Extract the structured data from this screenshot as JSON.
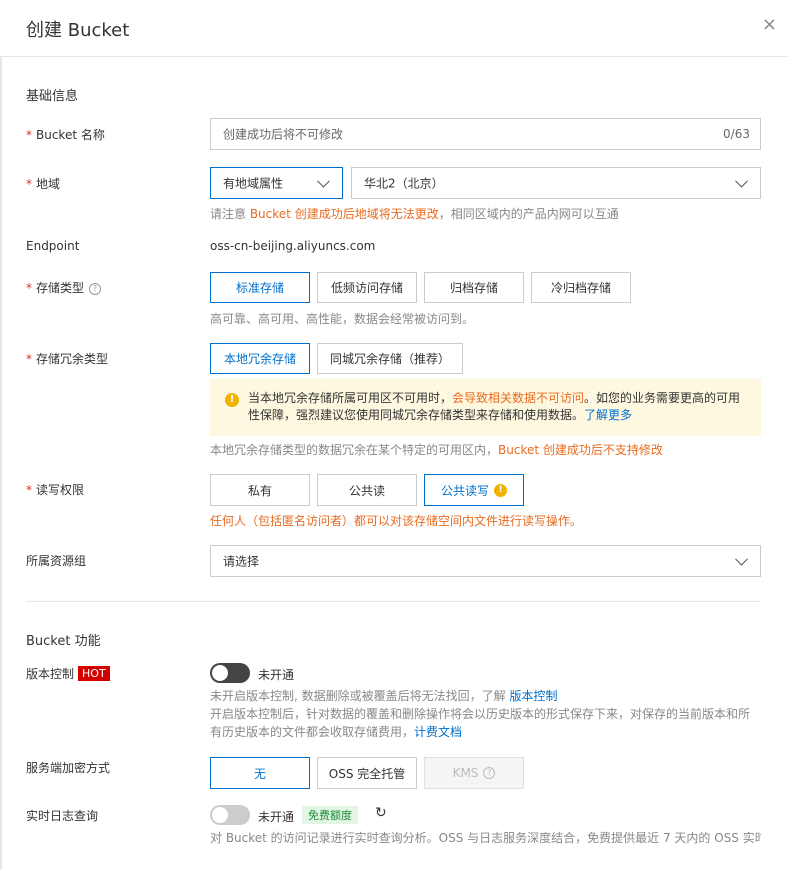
{
  "header": {
    "title": "创建 Bucket",
    "close": "×"
  },
  "basic": {
    "section_title": "基础信息",
    "name": {
      "label": "Bucket 名称",
      "placeholder": "创建成功后将不可修改",
      "count": "0/63"
    },
    "region": {
      "label": "地域",
      "type_value": "有地域属性",
      "region_value": "华北2（北京）",
      "hint_prefix": "请注意 ",
      "hint_orange": "Bucket 创建成功后地域将无法更改",
      "hint_suffix": "，相同区域内的产品内网可以互通"
    },
    "endpoint": {
      "label": "Endpoint",
      "value": "oss-cn-beijing.aliyuncs.com"
    },
    "storage_class": {
      "label": "存储类型",
      "options": [
        "标准存储",
        "低频访问存储",
        "归档存储",
        "冷归档存储"
      ],
      "selected": "标准存储",
      "hint": "高可靠、高可用、高性能，数据会经常被访问到。"
    },
    "redundancy": {
      "label": "存储冗余类型",
      "options": [
        "本地冗余存储",
        "同城冗余存储（推荐）"
      ],
      "selected": "本地冗余存储",
      "warning_part1": "当本地冗余存储所属可用区不可用时，",
      "warning_orange": "会导致相关数据不可访问",
      "warning_part2": "。如您的业务需要更高的可用性保障，强烈建议您使用同城冗余存储类型来存储和使用数据。",
      "warning_link": "了解更多",
      "hint_prefix": "本地冗余存储类型的数据冗余在某个特定的可用区内，",
      "hint_orange": "Bucket 创建成功后不支持修改"
    },
    "acl": {
      "label": "读写权限",
      "options": [
        "私有",
        "公共读",
        "公共读写"
      ],
      "selected": "公共读写",
      "warn_icon": "!",
      "warning": "任何人（包括匿名访问者）都可以对该存储空间内文件进行读写操作。"
    },
    "resource_group": {
      "label": "所属资源组",
      "placeholder": "请选择"
    }
  },
  "features": {
    "section_title": "Bucket 功能",
    "versioning": {
      "label": "版本控制",
      "badge": "HOT",
      "status": "未开通",
      "desc1_prefix": "未开启版本控制, 数据删除或被覆盖后将无法找回，了解 ",
      "desc1_link": "版本控制",
      "desc2_prefix": "开启版本控制后，针对数据的覆盖和删除操作将会以历史版本的形式保存下来，对保存的当前版本和所有历史版本的文件都会收取存储费用，",
      "desc2_link": "计费文档"
    },
    "encryption": {
      "label": "服务端加密方式",
      "options": [
        "无",
        "OSS 完全托管",
        "KMS"
      ],
      "selected": "无",
      "q": "?"
    },
    "log_query": {
      "label": "实时日志查询",
      "status": "未开通",
      "badge": "免费额度",
      "refresh": "↻",
      "desc": "对 Bucket 的访问记录进行实时查询分析。OSS 与日志服务深度结合，免费提供最近 7 天内的 OSS 实时"
    }
  },
  "colors": {
    "primary": "#0070cc",
    "orange": "#e86b1f",
    "required": "#d93026",
    "hot": "#d40000",
    "warn_bg": "#fff8e1"
  }
}
